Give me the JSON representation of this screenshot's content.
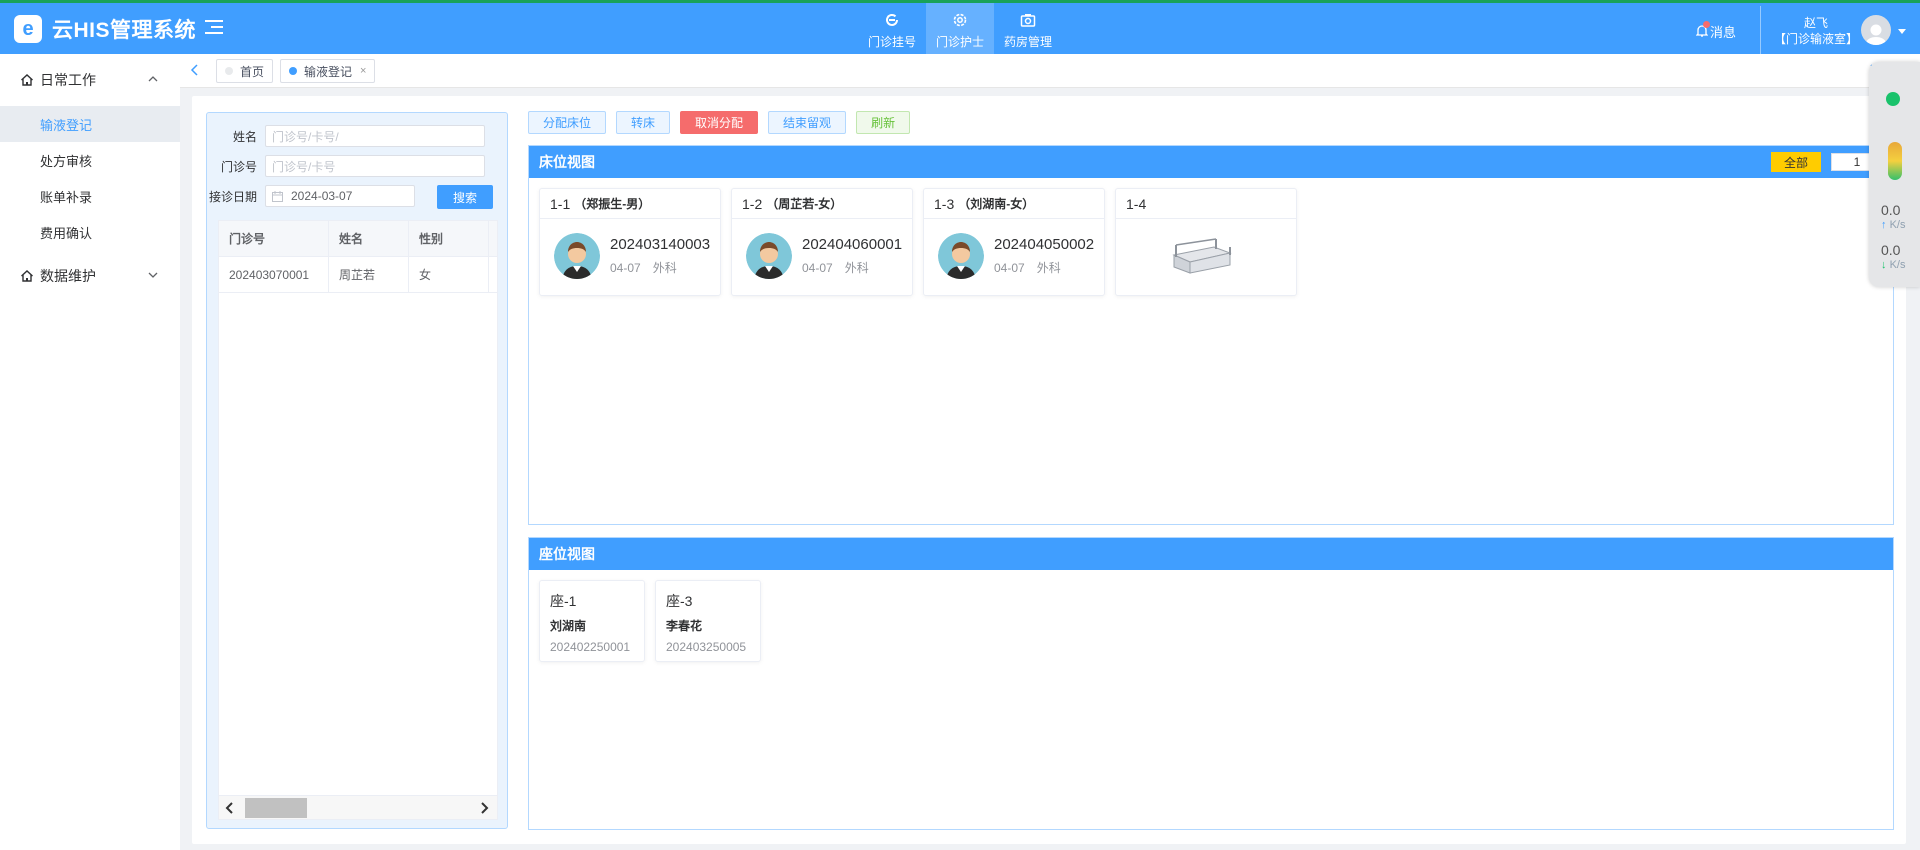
{
  "header": {
    "app_name": "云HIS管理系统",
    "modules": [
      {
        "label": "门诊挂号",
        "icon": "registration-icon",
        "active": false
      },
      {
        "label": "门诊护士",
        "icon": "gear-icon",
        "active": true
      },
      {
        "label": "药房管理",
        "icon": "camera-icon",
        "active": false
      }
    ],
    "message_label": "消息",
    "user_name": "赵飞",
    "user_dept": "【门诊输液室】"
  },
  "sidebar": {
    "groups": [
      {
        "label": "日常工作",
        "icon": "home-icon",
        "expanded": true,
        "items": [
          {
            "label": "输液登记",
            "active": true
          },
          {
            "label": "处方审核",
            "active": false
          },
          {
            "label": "账单补录",
            "active": false
          },
          {
            "label": "费用确认",
            "active": false
          }
        ]
      },
      {
        "label": "数据维护",
        "icon": "home-icon",
        "expanded": false,
        "items": []
      }
    ]
  },
  "tags": [
    {
      "label": "首页",
      "active": false
    },
    {
      "label": "输液登记",
      "active": true,
      "close": "×"
    }
  ],
  "search": {
    "name_label": "姓名",
    "name_placeholder": "门诊号/卡号/",
    "clinic_label": "门诊号",
    "clinic_placeholder": "门诊号/卡号",
    "date_label": "接诊日期",
    "date_value": "2024-03-07",
    "search_button": "搜索"
  },
  "patient_table": {
    "headers": [
      "门诊号",
      "姓名",
      "性别"
    ],
    "rows": [
      [
        "202403070001",
        "周芷若",
        "女"
      ]
    ]
  },
  "actions": {
    "assign_bed": "分配床位",
    "transfer_bed": "转床",
    "cancel_assign": "取消分配",
    "end_observation": "结束留观",
    "refresh": "刷新"
  },
  "bed_view": {
    "title": "床位视图",
    "all_button": "全部",
    "page_value": "1",
    "beds": [
      {
        "code": "1-1",
        "patient": "（郑振生-男）",
        "number": "202403140003",
        "date": "04-07",
        "dept": "外科",
        "occupied": true
      },
      {
        "code": "1-2",
        "patient": "（周芷若-女）",
        "number": "202404060001",
        "date": "04-07",
        "dept": "外科",
        "occupied": true
      },
      {
        "code": "1-3",
        "patient": "（刘湖南-女）",
        "number": "202404050002",
        "date": "04-07",
        "dept": "外科",
        "occupied": true
      },
      {
        "code": "1-4",
        "patient": "",
        "number": "",
        "date": "",
        "dept": "",
        "occupied": false
      }
    ]
  },
  "seat_view": {
    "title": "座位视图",
    "seats": [
      {
        "code": "座-1",
        "name": "刘湖南",
        "number": "202402250001"
      },
      {
        "code": "座-3",
        "name": "李春花",
        "number": "202403250005"
      }
    ]
  },
  "speed_widget": {
    "up_value": "0.0",
    "up_unit": "K/s",
    "down_value": "0.0",
    "down_unit": "K/s"
  }
}
